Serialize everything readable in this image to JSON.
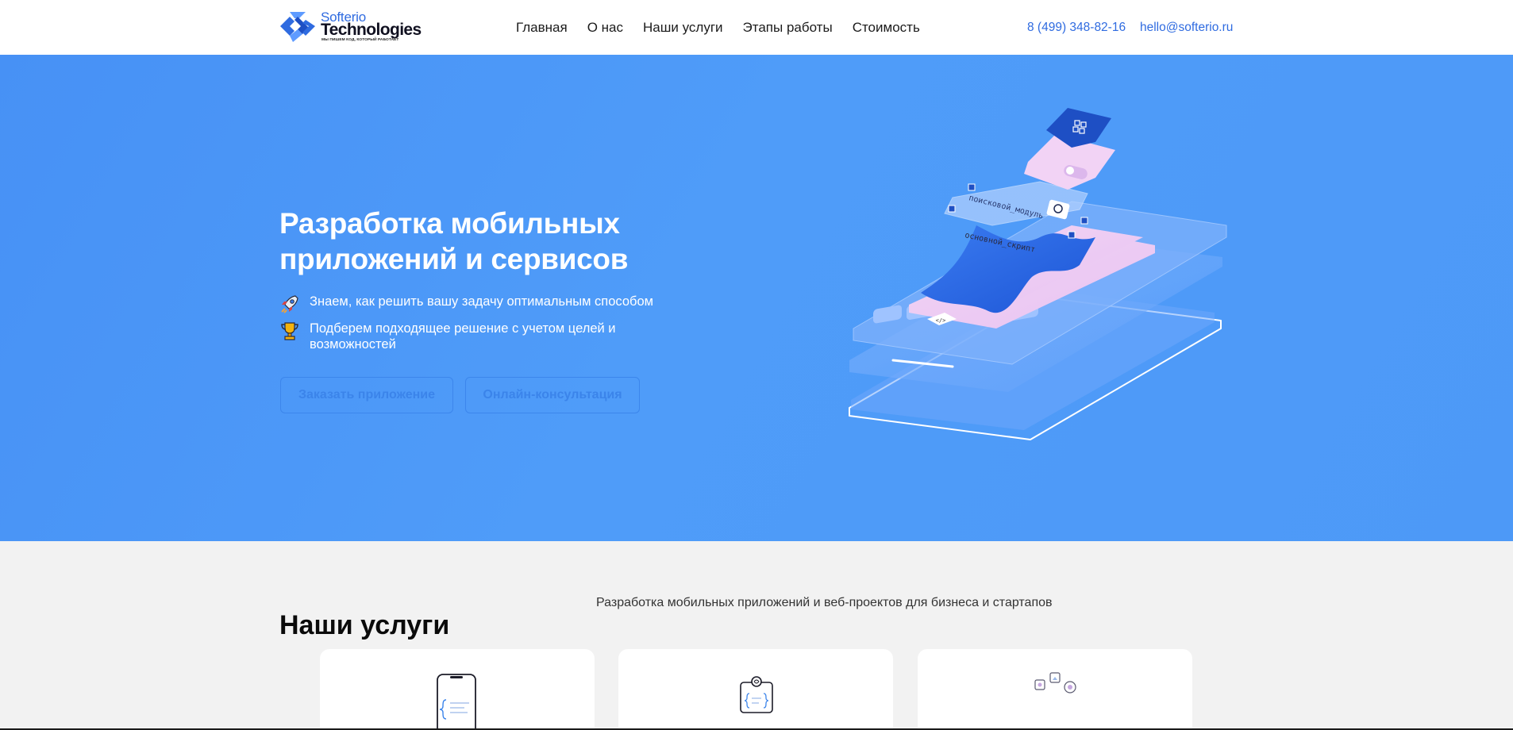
{
  "header": {
    "logo": {
      "line1": "Softerio",
      "line2": "Technologies",
      "tagline": "МЫ ПИШЕМ КОД, КОТОРЫЙ РАБОТАЕТ"
    },
    "nav": [
      "Главная",
      "О нас",
      "Наши услуги",
      "Этапы работы",
      "Стоимость"
    ],
    "phone": "8 (499) 348-82-16",
    "email": "hello@softerio.ru"
  },
  "hero": {
    "title": "Разработка мобильных приложений и сервисов",
    "features": [
      {
        "icon": "rocket-icon",
        "text": "Знаем, как решить вашу задачу оптимальным способом"
      },
      {
        "icon": "trophy-icon",
        "text": "Подберем подходящее решение с учетом целей и возможностей"
      }
    ],
    "buttons": {
      "order": "Заказать приложение",
      "consult": "Онлайн-консультация"
    },
    "illustration": {
      "label_search": "поисковой_модуль",
      "label_main": "основной_скрипт",
      "code_symbol": "</>"
    }
  },
  "services": {
    "subtitle": "Разработка мобильных приложений и веб-проектов для бизнеса и стартапов",
    "title": "Наши услуги",
    "cards": [
      {
        "icon": "mobile-code-icon"
      },
      {
        "icon": "web-code-icon"
      },
      {
        "icon": "design-elements-icon"
      }
    ]
  },
  "colors": {
    "accent": "#2f6be0",
    "hero_bg": "#4d99f7",
    "button": "#3b84ea",
    "section_bg": "#f2f2f2"
  }
}
